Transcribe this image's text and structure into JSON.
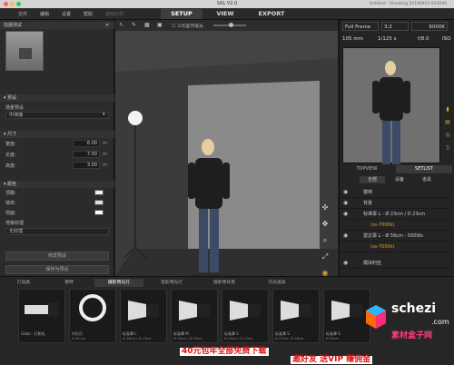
{
  "app": {
    "title": "SAL V2.0",
    "subtitle": "Untitled - Shooting 20190915 013640"
  },
  "menu": {
    "file": "文件",
    "edit": "编辑",
    "settings": "设置",
    "help": "帮助",
    "extra": "使用向导"
  },
  "modes": {
    "setup": "SETUP",
    "view": "VIEW",
    "export": "EXPORT"
  },
  "left": {
    "header": "拍摄测试",
    "preset_section": "预设",
    "preset_label": "场景预设",
    "preset_value": "中演播",
    "size_section": "尺寸",
    "width_label": "宽度:",
    "width_value": "6.00",
    "width_unit": "m",
    "length_label": "长度:",
    "length_value": "7.50",
    "length_unit": "m",
    "height_label": "高度:",
    "height_value": "3.00",
    "height_unit": "m",
    "color_section": "颜色",
    "ceiling_label": "顶棚:",
    "wall_label": "墙体:",
    "floor_label": "地面:",
    "texture_label": "地板纹理",
    "texture_value": "无纹理",
    "btn_modify": "修改预设",
    "btn_save": "保存为预设"
  },
  "viewport": {
    "toggle_label": "工作室环境光"
  },
  "camera": {
    "frame": "Full Frame",
    "ratio": "3:2",
    "wb": "6000K",
    "focal": "105 mm",
    "shutter": "1/125 s",
    "aperture": "f/8.0",
    "iso": "ISO"
  },
  "right_tabs": {
    "topview": "TOPVIEW",
    "setlist": "SETLIST"
  },
  "setlist_tabs": [
    "全部",
    "设备",
    "道具"
  ],
  "layers": [
    {
      "label": "模特"
    },
    {
      "label": "背景"
    },
    {
      "label": "标准罩 L - Ø 23cm / D 23cm"
    },
    {
      "label": "(ss-7000k)"
    },
    {
      "label": "雷达罩 L - Ø 56cm - 500Ws"
    },
    {
      "label": "(ss-7000k)"
    },
    {
      "label": "模拟利亚"
    }
  ],
  "library": {
    "tabs": [
      "灯具类",
      "模特",
      "摄影用光灯",
      "电影用光灯",
      "摄影用背景",
      "闪光道具"
    ],
    "cards": [
      {
        "name": "Gobo - 灯影机",
        "spec": "Ø 30cm"
      },
      {
        "name": "环形灯",
        "spec": "Ø 30 cm"
      },
      {
        "name": "标准罩 L",
        "spec": "Ø 18cm / D 13cm"
      },
      {
        "name": "标准罩 M",
        "spec": "Ø 23cm / D 23cm"
      },
      {
        "name": "标准罩 S",
        "spec": "Ø 20cm / D 17cm"
      },
      {
        "name": "标准罩 S",
        "spec": "Ø 27cm / D 26cm"
      },
      {
        "name": "标准罩 S",
        "spec": "Ø 25cm"
      }
    ]
  },
  "promo": {
    "line1": "40元包年全部免费下载",
    "line2": "邀好友 送VIP 赚佣金"
  },
  "logo": {
    "text": "schezi",
    "domain": ".com",
    "cn": "素材盒子网"
  },
  "colors": {
    "accent": "#e0a020",
    "red": "#d11"
  }
}
